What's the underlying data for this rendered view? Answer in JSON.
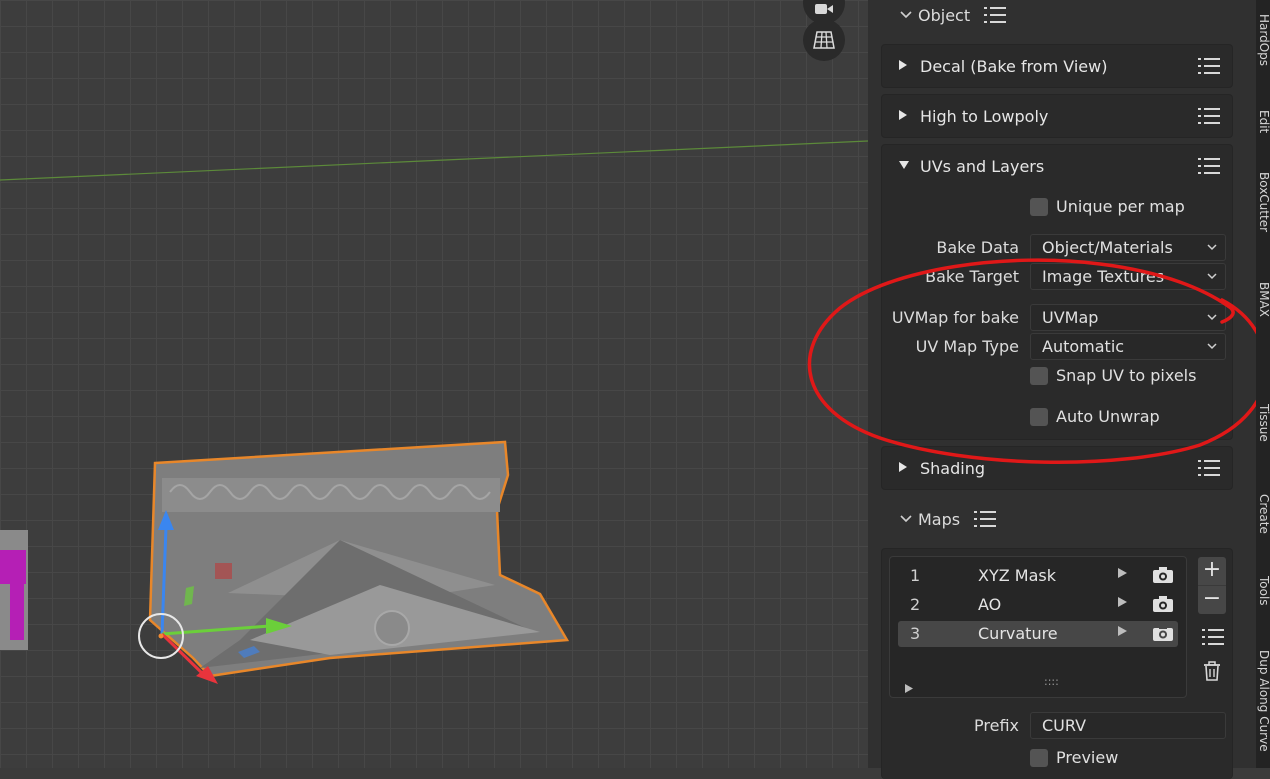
{
  "viewport": {
    "icons": [
      "camera-icon",
      "grid-view-icon"
    ]
  },
  "panel": {
    "object_section": {
      "title": "Object"
    },
    "subpanels": {
      "decal": {
        "label": "Decal (Bake from View)"
      },
      "high_low": {
        "label": "High to Lowpoly"
      },
      "uvs_layers": {
        "label": "UVs and Layers"
      },
      "shading": {
        "label": "Shading"
      }
    },
    "uvs": {
      "unique_per_map": "Unique per map",
      "bake_data_label": "Bake Data",
      "bake_data_value": "Object/Materials",
      "bake_target_label": "Bake Target",
      "bake_target_value": "Image Textures",
      "uvmap_label": "UVMap for bake",
      "uvmap_value": "UVMap",
      "uvmap_type_label": "UV Map Type",
      "uvmap_type_value": "Automatic",
      "snap_uv": "Snap UV to pixels",
      "auto_unwrap": "Auto Unwrap"
    },
    "maps_section": {
      "title": "Maps"
    },
    "maps": [
      {
        "num": "1",
        "name": "XYZ Mask"
      },
      {
        "num": "2",
        "name": "AO"
      },
      {
        "num": "3",
        "name": "Curvature"
      }
    ],
    "selected_map": "Curvature",
    "list_grip": "::::",
    "add": "+",
    "remove": "−",
    "prefix_label": "Prefix",
    "prefix_value": "CURV",
    "preview_label": "Preview"
  },
  "tabs": [
    "HardOps",
    "Edit",
    "BoxCutter",
    "BMAX",
    "Tissue",
    "Create",
    "Tools",
    "Dup Along Curve"
  ],
  "colors": {
    "selection_outline": "#e8872a",
    "annotation": "#e01818",
    "axis_x": "#e8343c",
    "axis_y": "#6bcf3a",
    "axis_z": "#3a86f0"
  }
}
